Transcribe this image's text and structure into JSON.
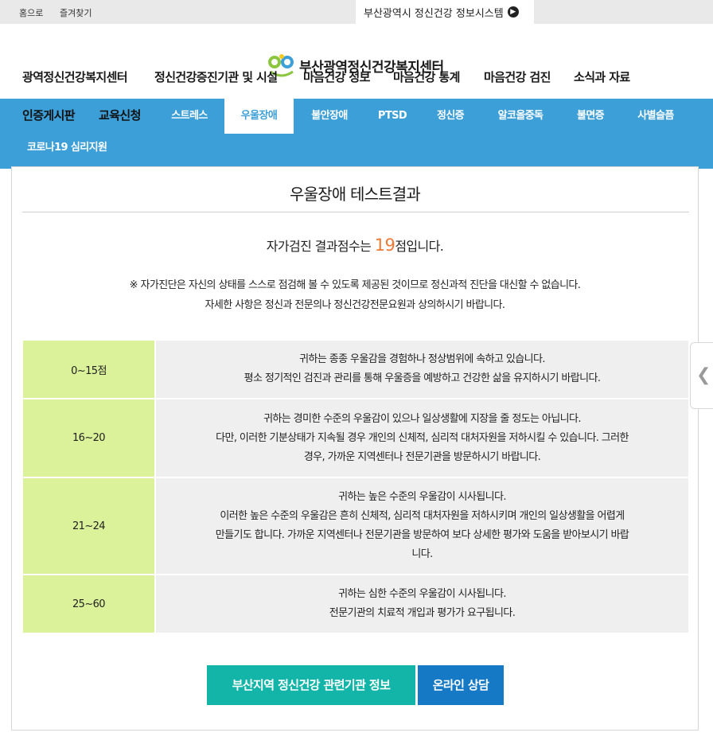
{
  "topbar": {
    "home": "홈으로",
    "favorites": "즐겨찾기",
    "system": "부산광역시 정신건강 정보시스템",
    "system_icon": "chevron-right-circle-icon"
  },
  "header": {
    "logo_text": "부산광역정신건강복지센터",
    "logo_icon": "center-logo-icon",
    "nav": [
      "광역정신건강복지센터",
      "정신건강증진기관 및 시설",
      "마음건강 정보",
      "마음건강 통계",
      "마음건강 검진",
      "소식과 자료"
    ]
  },
  "subnav": {
    "side": [
      "인증게시판",
      "교육신청"
    ],
    "tabs": [
      "스트레스",
      "우울장애",
      "불안장애",
      "PTSD",
      "정신증",
      "알코올중독",
      "불면증",
      "사별슬픔"
    ],
    "active_tab": "우울장애",
    "second_row": "코로나19 심리지원"
  },
  "result": {
    "title": "우울장애 테스트결과",
    "score_prefix": "자가검진 결과점수는 ",
    "score": "19",
    "score_suffix": "점입니다.",
    "notice_line1": "※ 자가진단은 자신의 상태를 스스로 점검해 볼 수 있도록 제공된 것이므로 정신과적 진단을 대신할 수 없습니다.",
    "notice_line2": "자세한 사항은 정신과 전문의나 정신건강전문요원과 상의하시기 바랍니다.",
    "rows": [
      {
        "range": "0~15점",
        "lines": [
          "귀하는 종종 우울감을 경험하나 정상범위에 속하고 있습니다.",
          "평소 정기적인 검진과 관리를 통해 우울증을 예방하고 건강한 삶을 유지하시기 바랍니다."
        ]
      },
      {
        "range": "16~20",
        "lines": [
          "귀하는 경미한 수준의 우울감이 있으나 일상생활에 지장을 줄 정도는 아닙니다.",
          "다만, 이러한 기분상태가 지속될 경우 개인의 신체적, 심리적 대처자원을 저하시킬 수 있습니다. 그러한",
          "경우, 가까운 지역센터나 전문기관을 방문하시기 바랍니다."
        ]
      },
      {
        "range": "21~24",
        "lines": [
          "귀하는 높은 수준의 우울감이 시사됩니다.",
          "이러한 높은 수준의 우울감은 흔히 신체적, 심리적 대처자원을 저하시키며 개인의 일상생활을 어렵게",
          "만들기도 합니다. 가까운 지역센터나 전문기관을 방문하여 보다 상세한 평가와 도움을 받아보시기 바랍",
          "니다."
        ]
      },
      {
        "range": "25~60",
        "lines": [
          "귀하는 심한 수준의 우울감이 시사됩니다.",
          "전문기관의 치료적 개입과 평가가 요구됩니다."
        ]
      }
    ],
    "buttons": {
      "institutions": "부산지역 정신건강 관련기관 정보",
      "counsel": "온라인 상담"
    }
  },
  "colors": {
    "nav_blue": "#3d9fd8",
    "score_orange": "#f07a34",
    "range_green": "#dbf19a",
    "teal_button": "#12b5a8",
    "blue_button": "#1579c6"
  },
  "side_handle_icon": "chevron-left-icon"
}
